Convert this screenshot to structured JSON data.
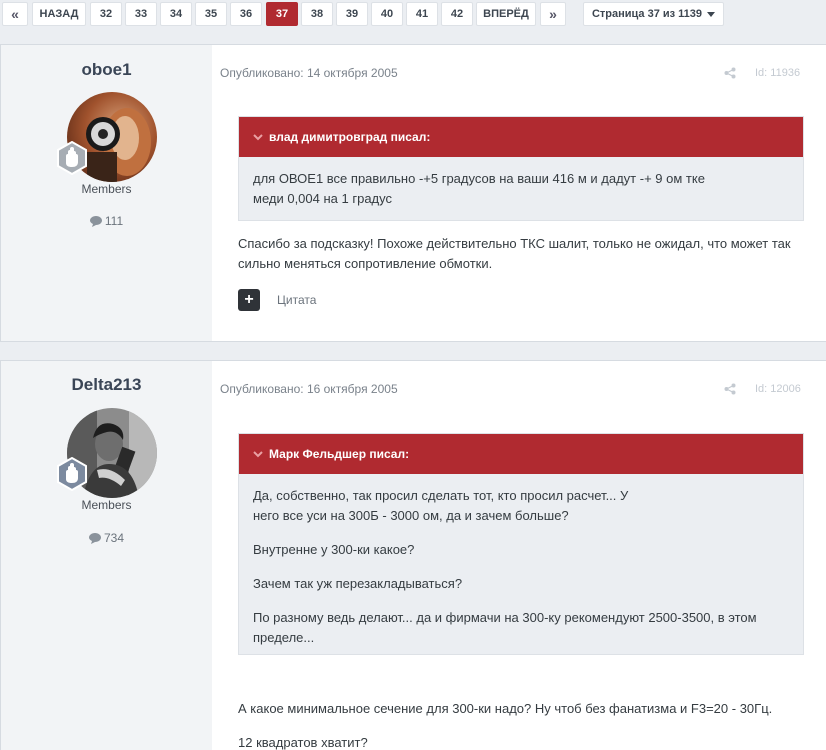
{
  "pagination": {
    "first": "«",
    "prev": "НАЗАД",
    "pages": [
      "32",
      "33",
      "34",
      "35",
      "36",
      "37",
      "38",
      "39",
      "40",
      "41",
      "42"
    ],
    "active_page": "37",
    "next": "ВПЕРЁД",
    "last": "»",
    "page_of": "Страница 37 из 1139"
  },
  "colors": {
    "accent": "#b02a30",
    "quote_bg": "#ebeef2",
    "author_bg": "#f2f4f6"
  },
  "posts": [
    {
      "author": "oboe1",
      "group": "Members",
      "post_count": "111",
      "published": "Опубликовано: 14 октября 2005",
      "post_id": "Id: 11936",
      "quote": {
        "author": "влад димитровград писал:",
        "paragraphs": [
          "для ОВОЕ1 все правильно -+5 градусов на ваши 416 м и дадут -+ 9 ом тке меди 0,004 на 1 градус"
        ]
      },
      "paragraphs": [
        "Спасибо за подсказку! Похоже действительно ТКС шалит, только не ожидал, что может так сильно меняться сопротивление обмотки."
      ],
      "quote_button": "Цитата"
    },
    {
      "author": "Delta213",
      "group": "Members",
      "post_count": "734",
      "published": "Опубликовано: 16 октября 2005",
      "post_id": "Id: 12006",
      "quote": {
        "author": "Марк Фельдшер писал:",
        "paragraphs": [
          "Да, собственно, так просил сделать тот, кто просил расчет... У него все уси на 300Б - 3000 ом, да и зачем больше?",
          "Внутренне у 300-ки какое?",
          "Зачем так уж перезакладываться?",
          "По разному ведь делают... да и фирмачи на 300-ку рекомендуют 2500-3500, в этом пределе..."
        ]
      },
      "paragraphs": [
        "А какое минимальное сечение для 300-ки надо? Ну чтоб без фанатизма и F3=20 - 30Гц.",
        "12 квадратов хватит?"
      ]
    }
  ]
}
